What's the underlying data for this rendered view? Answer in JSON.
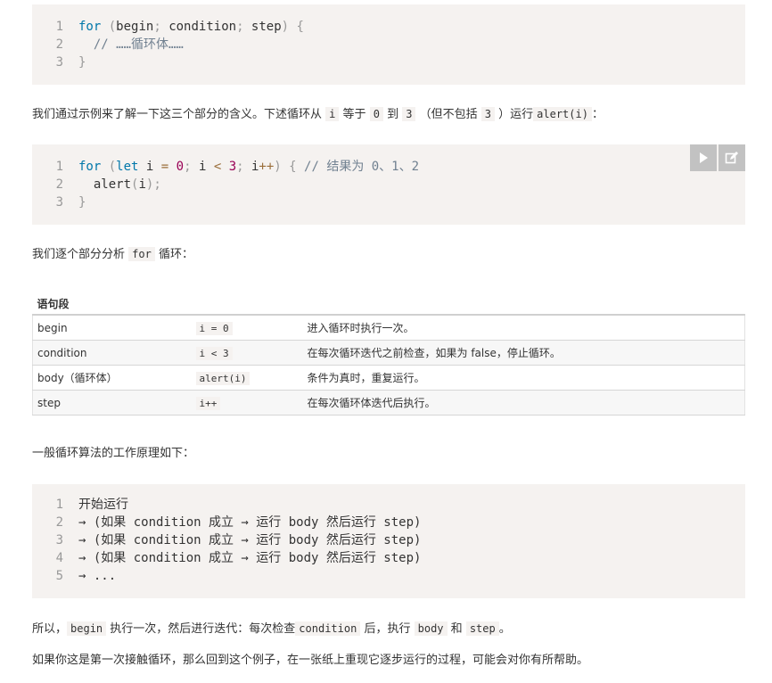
{
  "code1": {
    "lines": [
      {
        "n": "1",
        "parts": [
          [
            "kw",
            "for"
          ],
          [
            "",
            " "
          ],
          [
            "pn",
            "("
          ],
          [
            "",
            "begin"
          ],
          [
            "pn",
            ";"
          ],
          [
            "",
            " condition"
          ],
          [
            "pn",
            ";"
          ],
          [
            "",
            " step"
          ],
          [
            "pn",
            ")"
          ],
          [
            "",
            " "
          ],
          [
            "pn",
            "{"
          ]
        ]
      },
      {
        "n": "2",
        "parts": [
          [
            "cm",
            "  // ……循环体……"
          ]
        ]
      },
      {
        "n": "3",
        "parts": [
          [
            "pn",
            "}"
          ]
        ]
      }
    ]
  },
  "para1": {
    "t1": "我们通过示例来了解一下这三个部分的含义。下述循环从",
    "c1": "i",
    "t2": "等于",
    "c2": "0",
    "t3": "到",
    "c3": "3",
    "t4": "（但不包括",
    "c4": "3",
    "t5": "）运行",
    "c5": "alert(i)",
    "t6": "："
  },
  "code2": {
    "lines": [
      {
        "n": "1",
        "parts": [
          [
            "kw",
            "for"
          ],
          [
            "",
            " "
          ],
          [
            "pn",
            "("
          ],
          [
            "kw",
            "let"
          ],
          [
            "",
            " i "
          ],
          [
            "op",
            "="
          ],
          [
            "",
            " "
          ],
          [
            "num",
            "0"
          ],
          [
            "pn",
            ";"
          ],
          [
            "",
            " i "
          ],
          [
            "op",
            "<"
          ],
          [
            "",
            " "
          ],
          [
            "num",
            "3"
          ],
          [
            "pn",
            ";"
          ],
          [
            "",
            " i"
          ],
          [
            "op",
            "++"
          ],
          [
            "pn",
            ")"
          ],
          [
            "",
            " "
          ],
          [
            "pn",
            "{"
          ],
          [
            "",
            " "
          ],
          [
            "cm",
            "// 结果为 0、1、2"
          ]
        ]
      },
      {
        "n": "2",
        "parts": [
          [
            "",
            "  alert"
          ],
          [
            "pn",
            "("
          ],
          [
            "",
            "i"
          ],
          [
            "pn",
            ")"
          ],
          [
            "pn",
            ";"
          ]
        ]
      },
      {
        "n": "3",
        "parts": [
          [
            "pn",
            "}"
          ]
        ]
      }
    ]
  },
  "para2": {
    "t1": "我们逐个部分分析",
    "c1": "for",
    "t2": "循环："
  },
  "table": {
    "header": "语句段",
    "rows": [
      {
        "name": "begin",
        "code": "i = 0",
        "desc": "进入循环时执行一次。"
      },
      {
        "name": "condition",
        "code": "i < 3",
        "desc": "在每次循环迭代之前检查，如果为 false，停止循环。"
      },
      {
        "name": "body（循环体）",
        "code": "alert(i)",
        "desc": "条件为真时，重复运行。"
      },
      {
        "name": "step",
        "code": "i++",
        "desc": "在每次循环体迭代后执行。"
      }
    ]
  },
  "para3": "一般循环算法的工作原理如下：",
  "code3": {
    "lines": [
      {
        "n": "1",
        "text": "开始运行"
      },
      {
        "n": "2",
        "text": "→ (如果 condition 成立 → 运行 body 然后运行 step)"
      },
      {
        "n": "3",
        "text": "→ (如果 condition 成立 → 运行 body 然后运行 step)"
      },
      {
        "n": "4",
        "text": "→ (如果 condition 成立 → 运行 body 然后运行 step)"
      },
      {
        "n": "5",
        "text": "→ ..."
      }
    ]
  },
  "para4": {
    "t1": "所以，",
    "c1": "begin",
    "t2": "执行一次，然后进行迭代：每次检查",
    "c2": "condition",
    "t3": "后，执行",
    "c3": "body",
    "t4": "和",
    "c4": "step",
    "t5": "。"
  },
  "para5": "如果你这是第一次接触循环，那么回到这个例子，在一张纸上重现它逐步运行的过程，可能会对你有所帮助。",
  "icons": {
    "run": "play-icon",
    "edit": "edit-icon"
  },
  "colors": {
    "code_bg": "#f5f2f0",
    "keyword": "#0077aa",
    "number": "#990055",
    "comment": "#708090",
    "button": "#c2c2c2"
  }
}
